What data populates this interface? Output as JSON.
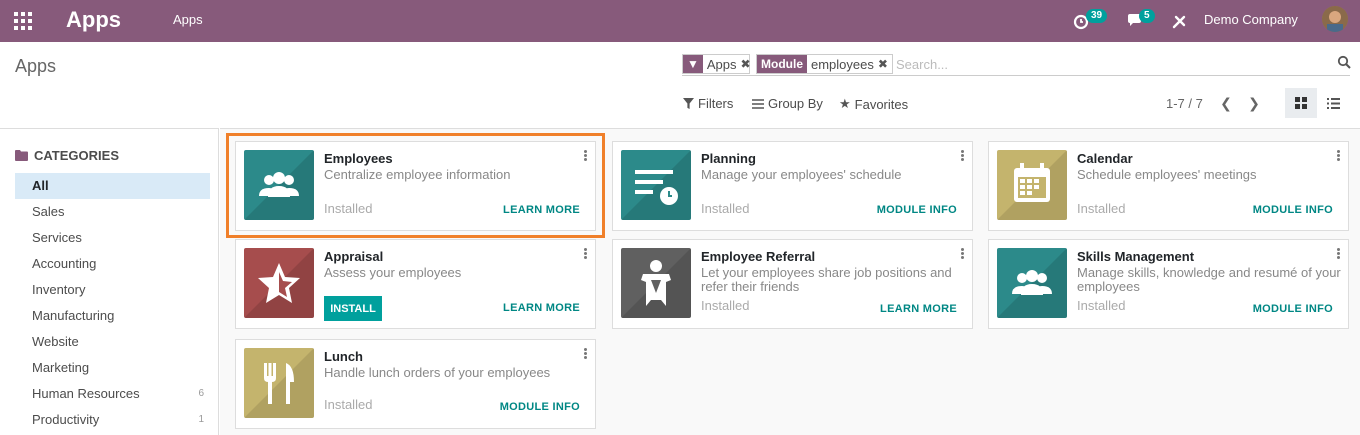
{
  "navbar": {
    "app_name": "Apps",
    "menu_apps": "Apps",
    "activity_count": "39",
    "messages_count": "5",
    "company": "Demo Company"
  },
  "control_panel": {
    "breadcrumb": "Apps",
    "facets": [
      {
        "label": "Apps",
        "icon": "filter-icon"
      },
      {
        "label_tag": "Module",
        "value": "employees"
      }
    ],
    "search_placeholder": "Search...",
    "filters_label": "Filters",
    "groupby_label": "Group By",
    "favorites_label": "Favorites",
    "pager": "1-7 / 7"
  },
  "sidebar": {
    "header": "CATEGORIES",
    "items": [
      {
        "label": "All",
        "count": ""
      },
      {
        "label": "Sales",
        "count": ""
      },
      {
        "label": "Services",
        "count": ""
      },
      {
        "label": "Accounting",
        "count": ""
      },
      {
        "label": "Inventory",
        "count": ""
      },
      {
        "label": "Manufacturing",
        "count": ""
      },
      {
        "label": "Website",
        "count": ""
      },
      {
        "label": "Marketing",
        "count": ""
      },
      {
        "label": "Human Resources",
        "count": "6"
      },
      {
        "label": "Productivity",
        "count": "1"
      }
    ]
  },
  "cards": [
    {
      "title": "Employees",
      "summary": "Centralize employee information",
      "status": "Installed",
      "action": "LEARN MORE",
      "icon": "employees-icon",
      "color": "#2c8a8a"
    },
    {
      "title": "Planning",
      "summary": "Manage your employees' schedule",
      "status": "Installed",
      "action": "MODULE INFO",
      "icon": "planning-icon",
      "color": "#2c8a8a"
    },
    {
      "title": "Calendar",
      "summary": "Schedule employees' meetings",
      "status": "Installed",
      "action": "MODULE INFO",
      "icon": "calendar-icon",
      "color": "#c4b46d"
    },
    {
      "title": "Appraisal",
      "summary": "Assess your employees",
      "status": "",
      "install": "INSTALL",
      "action": "LEARN MORE",
      "icon": "star-icon",
      "color": "#a64d4d"
    },
    {
      "title": "Employee Referral",
      "summary": "Let your employees share job positions and refer their friends",
      "status": "Installed",
      "action": "LEARN MORE",
      "icon": "referral-icon",
      "color": "#606060"
    },
    {
      "title": "Skills Management",
      "summary": "Manage skills, knowledge and resumé of your employees",
      "status": "Installed",
      "action": "MODULE INFO",
      "icon": "employees-icon",
      "color": "#2c8a8a"
    },
    {
      "title": "Lunch",
      "summary": "Handle lunch orders of your employees",
      "status": "Installed",
      "action": "MODULE INFO",
      "icon": "cutlery-icon",
      "color": "#c4b46d"
    }
  ]
}
